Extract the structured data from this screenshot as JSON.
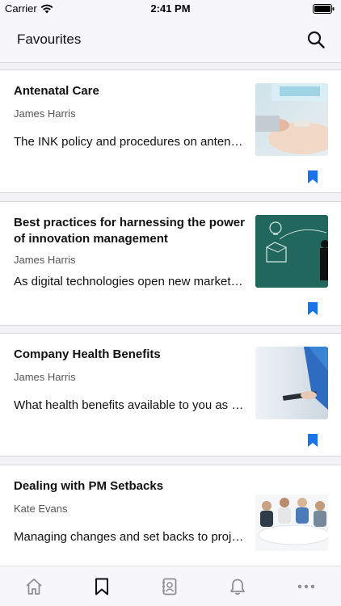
{
  "status_bar": {
    "carrier": "Carrier",
    "time": "2:41 PM"
  },
  "header": {
    "title": "Favourites",
    "search_icon": "search-icon"
  },
  "colors": {
    "accent": "#1a73e8",
    "tab_inactive": "#8e8e93",
    "tab_active": "#111111"
  },
  "articles": [
    {
      "title": "Antenatal Care",
      "author": "James Harris",
      "summary": "The INK policy and procedures on antenatal care",
      "image": "ultrasound-photo",
      "bookmarked": true
    },
    {
      "title": "Best practices for harnessing the power of innovation management",
      "author": "James Harris",
      "summary": "As digital technologies open new markets for innovation",
      "image": "chalkboard-photo",
      "bookmarked": true
    },
    {
      "title": "Company Health Benefits",
      "author": "James Harris",
      "summary": "What health benefits available to you as an employee",
      "image": "tablet-doctor-photo",
      "bookmarked": true
    },
    {
      "title": "Dealing with PM Setbacks",
      "author": "Kate Evans",
      "summary": "Managing changes and set backs to projects",
      "image": "meeting-photo",
      "bookmarked": true
    }
  ],
  "tab_bar": {
    "tabs": [
      {
        "name": "home-icon",
        "active": false
      },
      {
        "name": "bookmark-icon",
        "active": true
      },
      {
        "name": "contacts-icon",
        "active": false
      },
      {
        "name": "bell-icon",
        "active": false
      },
      {
        "name": "more-icon",
        "active": false
      }
    ]
  }
}
